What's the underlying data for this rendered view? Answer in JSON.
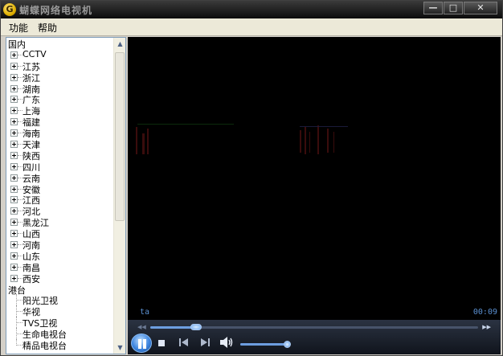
{
  "window": {
    "title": "蝴蝶网络电视机",
    "logo_letter": "G",
    "buttons": {
      "minimize": "—",
      "maximize": "□",
      "close": "✕"
    }
  },
  "menu": {
    "items": [
      "功能",
      "帮助"
    ]
  },
  "tree": {
    "groups": [
      {
        "label": "国内",
        "items": [
          "CCTV",
          "江苏",
          "浙江",
          "湖南",
          "广东",
          "上海",
          "福建",
          "海南",
          "天津",
          "陕西",
          "四川",
          "云南",
          "安徽",
          "江西",
          "河北",
          "黑龙江",
          "山西",
          "河南",
          "山东",
          "南昌",
          "西安"
        ]
      },
      {
        "label": "港台",
        "items": [
          "阳光卫视",
          "华视",
          "TVS卫视",
          "生命电视台",
          "精品电视台"
        ]
      }
    ]
  },
  "video": {
    "channel_label": "ta",
    "elapsed_time": "00:09"
  },
  "player": {
    "seek_progress": 0.14,
    "volume_level": 0.95,
    "icons": {
      "play_pause": "pause-icon",
      "stop": "stop-icon",
      "previous": "previous-icon",
      "next": "next-icon",
      "volume": "speaker-icon",
      "seek_back": "rewind-icon",
      "seek_forward": "fast-forward-icon"
    },
    "accent_color": "#6d9ee0"
  }
}
